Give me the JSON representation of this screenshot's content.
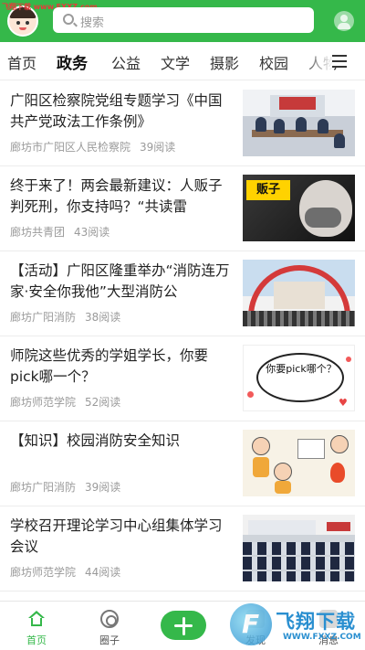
{
  "watermark": {
    "top_left": "飞翔下载 www.FXXZ.com",
    "brand": "飞翔下载",
    "url": "WWW.FXXZ.COM"
  },
  "header": {
    "search_placeholder": "搜索"
  },
  "tabs": [
    {
      "label": "首页"
    },
    {
      "label": "政务",
      "active": true
    },
    {
      "label": "公益"
    },
    {
      "label": "文学"
    },
    {
      "label": "摄影"
    },
    {
      "label": "校园"
    },
    {
      "label": "人物"
    }
  ],
  "feed": [
    {
      "title": "广阳区检察院党组专题学习《中国共产党政法工作条例》",
      "source": "廊坊市广阳区人民检察院",
      "reads": "39阅读",
      "thumb": "meeting-photo"
    },
    {
      "title": "终于来了！两会最新建议：人贩子判死刑，你支持吗？“共读雷",
      "source": "廊坊共青团",
      "reads": "43阅读",
      "thumb": "child-poster",
      "thumb_text": "贩子"
    },
    {
      "title": "【活动】广阳区隆重举办“消防连万家·安全你我他”大型消防公",
      "source": "廊坊广阳消防",
      "reads": "38阅读",
      "thumb": "fire-safety-event"
    },
    {
      "title": "师院这些优秀的学姐学长，你要pick哪一个？",
      "source": "廊坊师范学院",
      "reads": "52阅读",
      "thumb": "pick-bubble",
      "thumb_text": "你要pick哪个？"
    },
    {
      "title": "【知识】校园消防安全知识",
      "source": "廊坊广阳消防",
      "reads": "39阅读",
      "thumb": "cartoon-illustration"
    },
    {
      "title": "学校召开理论学习中心组集体学习会议",
      "source": "廊坊师范学院",
      "reads": "44阅读",
      "thumb": "conference-photo"
    }
  ],
  "bottom_nav": {
    "home": "首页",
    "circle": "圈子",
    "discover": "发现",
    "messages": "消息"
  },
  "colors": {
    "brand_green": "#35b84a",
    "meta_gray": "#9a9a9a"
  }
}
